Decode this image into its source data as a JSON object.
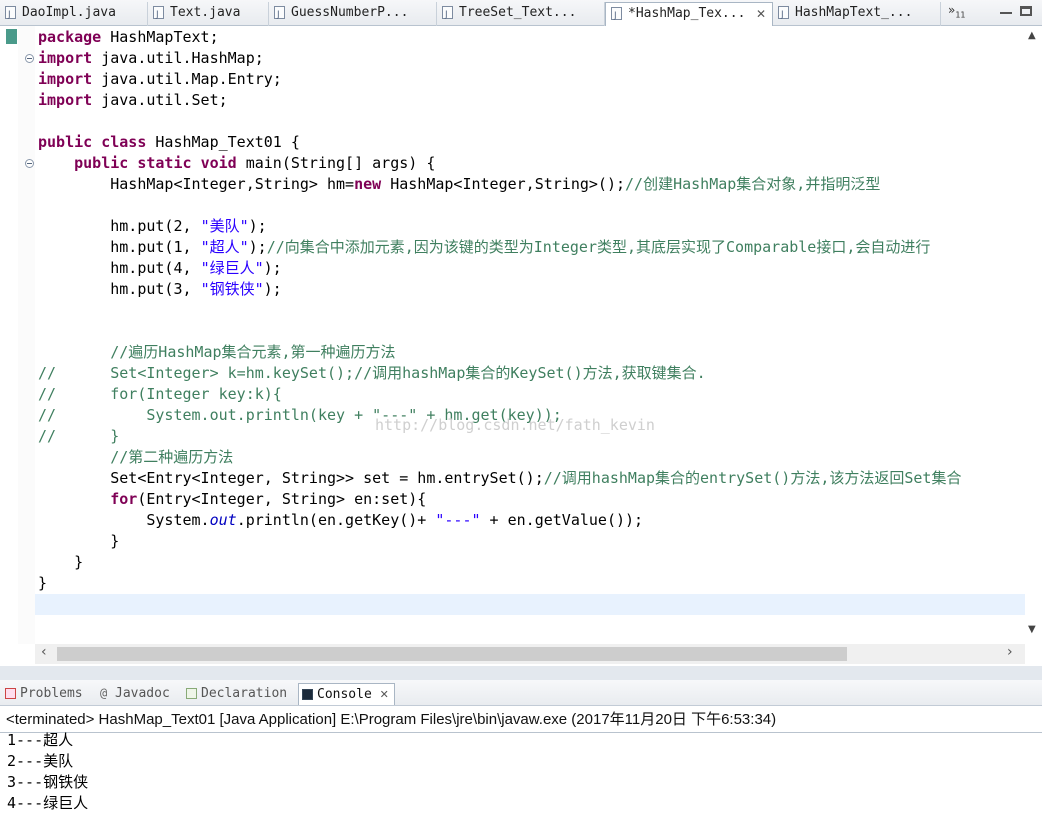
{
  "editor_tabs": [
    {
      "label": "DaoImpl.java",
      "active": false
    },
    {
      "label": "Text.java",
      "active": false
    },
    {
      "label": "GuessNumberP...",
      "active": false
    },
    {
      "label": "TreeSet_Text...",
      "active": false
    },
    {
      "label": "*HashMap_Tex...",
      "active": true
    },
    {
      "label": "HashMapText_...",
      "active": false
    }
  ],
  "tabs_overflow": {
    "arrow": "»",
    "count": "11"
  },
  "code": {
    "l1_kw": "package",
    "l1_rest": " HashMapText;",
    "l2_kw": "import",
    "l2_rest": " java.util.HashMap;",
    "l3_kw": "import",
    "l3_rest": " java.util.Map.Entry;",
    "l4_kw": "import",
    "l4_rest": " java.util.Set;",
    "l6_kw1": "public",
    "l6_kw2": "class",
    "l6_rest": " HashMap_Text01 {",
    "l7_ind": "    ",
    "l7_kw1": "public",
    "l7_kw2": "static",
    "l7_kw3": "void",
    "l7_rest": " main(String[] args) {",
    "l8_a": "        HashMap<Integer,String> hm=",
    "l8_kw": "new",
    "l8_b": " HashMap<Integer,String>();",
    "l8_cmt": "//创建HashMap集合对象,并指明泛型",
    "l10_a": "        hm.put(2, ",
    "l10_str": "\"美队\"",
    "l10_b": ");",
    "l11_a": "        hm.put(1, ",
    "l11_str": "\"超人\"",
    "l11_b": ");",
    "l11_cmt": "//向集合中添加元素,因为该键的类型为Integer类型,其底层实现了Comparable接口,会自动进行",
    "l12_a": "        hm.put(4, ",
    "l12_str": "\"绿巨人\"",
    "l12_b": ");",
    "l13_a": "        hm.put(3, ",
    "l13_str": "\"钢铁侠\"",
    "l13_b": ");",
    "l16_cmt": "        //遍历HashMap集合元素,第一种遍历方法",
    "l17_cmt": "//      Set<Integer> k=hm.keySet();//调用hashMap集合的KeySet()方法,获取键集合.",
    "l18_cmt": "//      for(Integer key:k){",
    "l19_cmt": "//          System.out.println(key + \"---\" + hm.get(key));",
    "l20_cmt": "//      }",
    "l21_cmt": "        //第二种遍历方法",
    "l22_a": "        Set<Entry<Integer, String>> set = hm.entrySet();",
    "l22_cmt": "//调用hashMap集合的entrySet()方法,该方法返回Set集合",
    "l23_ind": "        ",
    "l23_kw": "for",
    "l23_rest": "(Entry<Integer, String> en:set){",
    "l24_a": "            System.",
    "l24_fld": "out",
    "l24_b": ".println(en.getKey()+ ",
    "l24_str": "\"---\"",
    "l24_c": " + en.getValue());",
    "l25": "        }",
    "l26": "    }",
    "l27": "}"
  },
  "watermark": "http://blog.csdn.net/fath_kevin",
  "view_tabs": [
    {
      "label": "Problems",
      "icon": "problems-icon"
    },
    {
      "label": "Javadoc",
      "icon": "javadoc-icon"
    },
    {
      "label": "Declaration",
      "icon": "declaration-icon"
    },
    {
      "label": "Console",
      "icon": "console-icon",
      "active": true
    }
  ],
  "console": {
    "terminated": "<terminated> HashMap_Text01 [Java Application] E:\\Program Files\\jre\\bin\\javaw.exe (2017年11月20日 下午6:53:34)",
    "output": [
      "1---超人",
      "2---美队",
      "3---钢铁侠",
      "4---绿巨人"
    ]
  },
  "colors": {
    "keyword": "#7f0055",
    "string": "#2a00ff",
    "comment": "#3f7f5f",
    "field": "#0000c0",
    "current_line": "#e8f2fe"
  }
}
